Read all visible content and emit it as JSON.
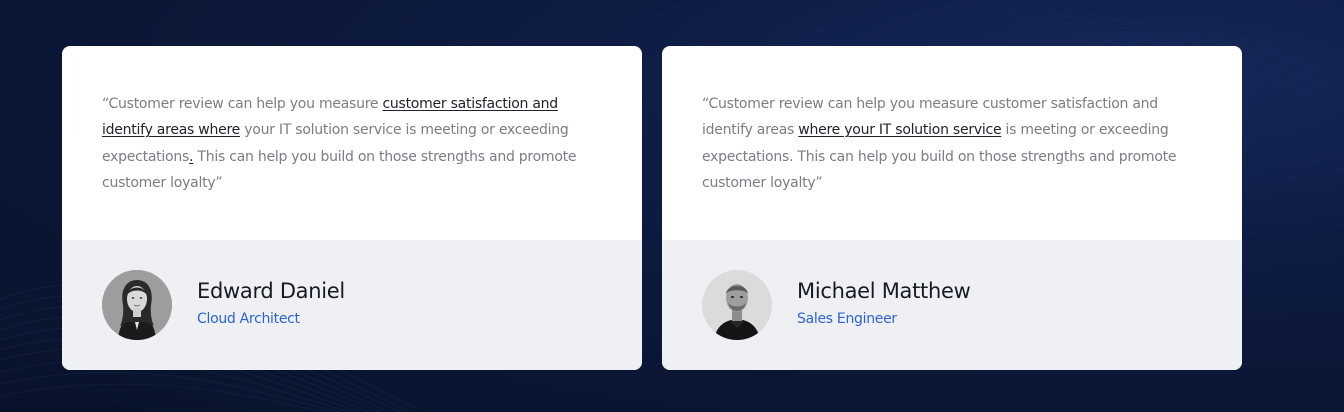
{
  "colors": {
    "background": "#0b1733",
    "card": "#ffffff",
    "card_footer": "#eff0f4",
    "quote_text": "#7a7d86",
    "link_text": "#20242f",
    "name_text": "#161a25",
    "role_text": "#2d63d4"
  },
  "testimonials": [
    {
      "quote_open": "“Customer review can help you measure ",
      "quote_link": "customer satisfaction and identify areas where",
      "quote_middle": " your IT solution service is meeting or exceeding expectations",
      "quote_link_2": ".",
      "quote_close": " This can help you build on those strengths and promote customer loyalty”",
      "name": "Edward Daniel",
      "role": "Cloud Architect",
      "avatar_icon": "avatar-woman-photo"
    },
    {
      "quote_open": "“Customer review can help you measure customer satisfaction and identify areas ",
      "quote_link": "where your IT solution service",
      "quote_close": " is meeting or exceeding expectations. This can help you build on those strengths and promote customer loyalty”",
      "name": "Michael Matthew",
      "role": "Sales Engineer",
      "avatar_icon": "avatar-man-photo"
    }
  ]
}
